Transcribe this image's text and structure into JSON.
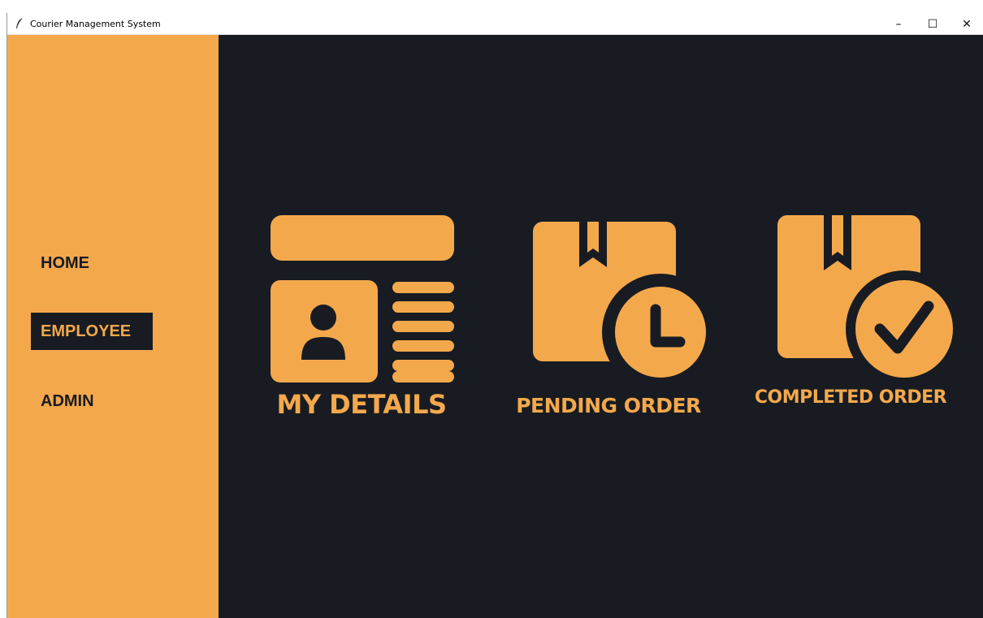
{
  "window": {
    "title": "Courier Management System",
    "controls": {
      "minimize": "–",
      "maximize": "☐",
      "close": "✕"
    }
  },
  "sidebar": {
    "items": [
      {
        "label": "HOME",
        "active": false
      },
      {
        "label": "EMPLOYEE",
        "active": true
      },
      {
        "label": "ADMIN",
        "active": false
      }
    ]
  },
  "tiles": [
    {
      "label": "MY DETAILS",
      "icon": "id-card-icon"
    },
    {
      "label": "PENDING ORDER",
      "icon": "package-clock-icon"
    },
    {
      "label": "COMPLETED ORDER",
      "icon": "package-check-icon"
    }
  ],
  "colors": {
    "accent": "#f4a84c",
    "background": "#181c22"
  }
}
